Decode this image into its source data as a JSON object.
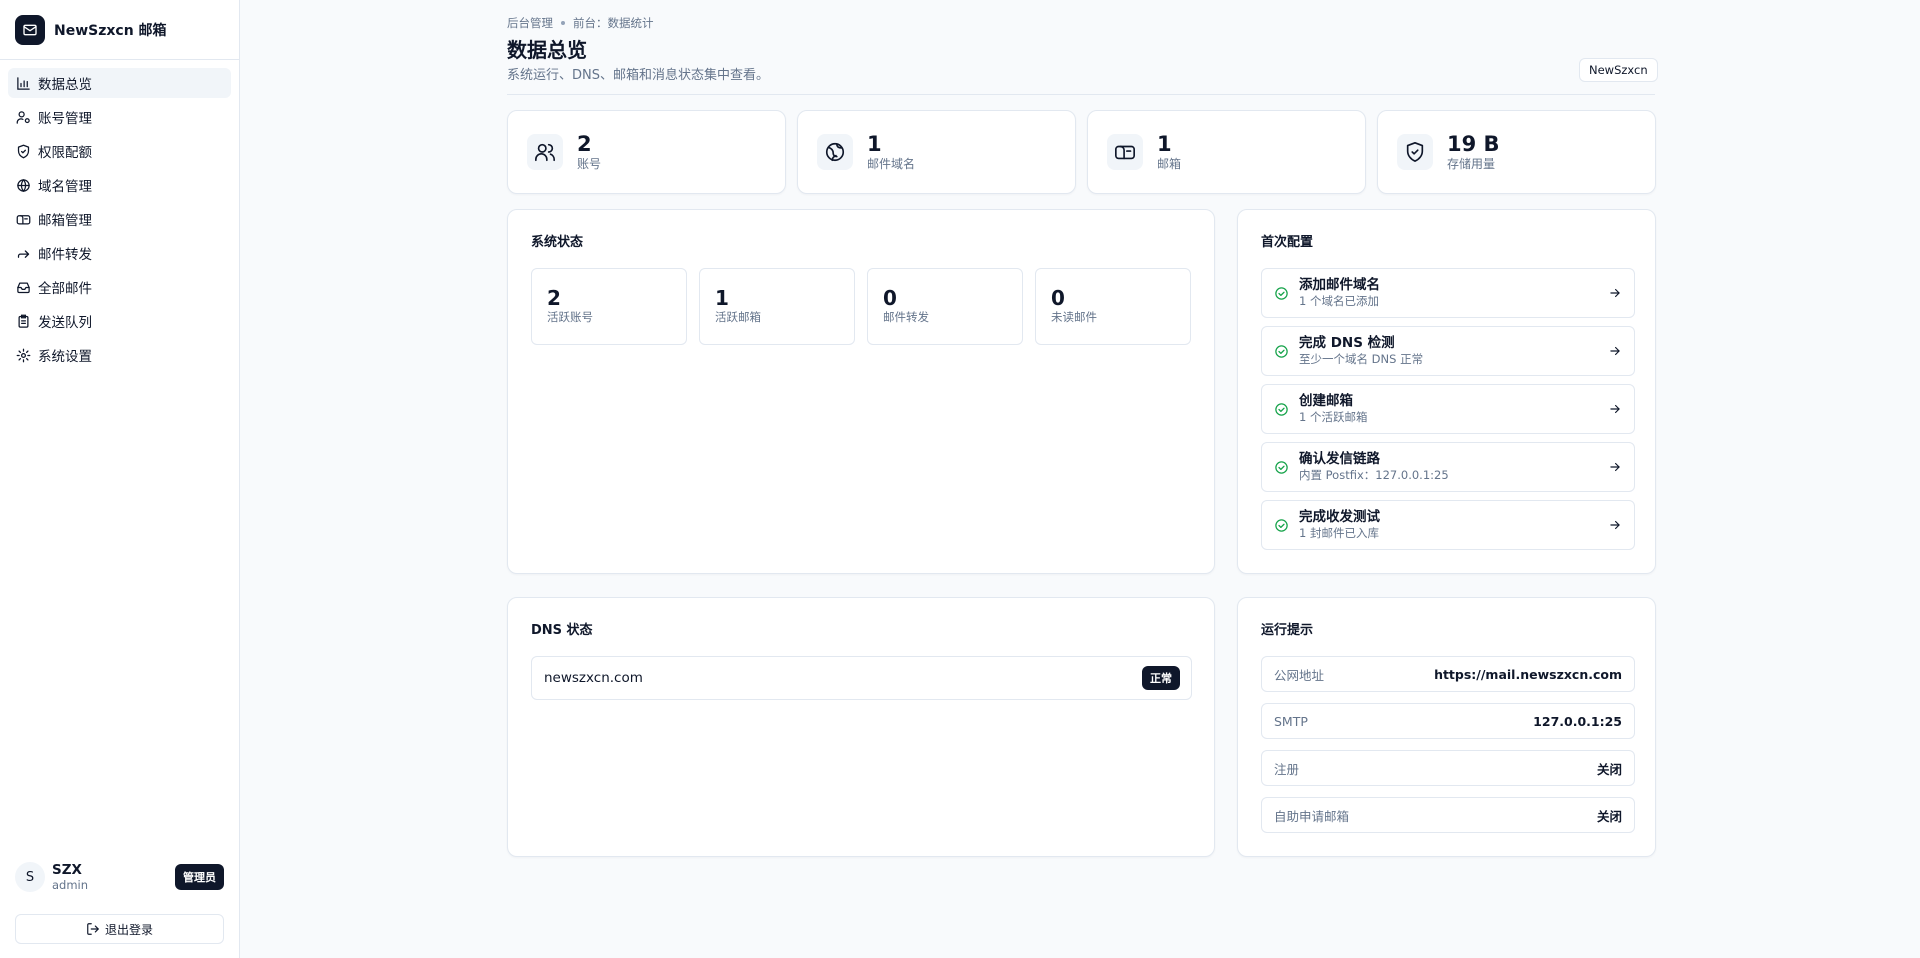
{
  "brand": {
    "name": "NewSzxcn 邮箱",
    "logo_icon": "mail-icon"
  },
  "sidebar": {
    "items": [
      {
        "label": "数据总览",
        "icon": "bar-chart-icon",
        "active": true
      },
      {
        "label": "账号管理",
        "icon": "user-settings-icon",
        "active": false
      },
      {
        "label": "权限配额",
        "icon": "shield-icon",
        "active": false
      },
      {
        "label": "域名管理",
        "icon": "globe-icon",
        "active": false
      },
      {
        "label": "邮箱管理",
        "icon": "mailbox-icon",
        "active": false
      },
      {
        "label": "邮件转发",
        "icon": "forward-icon",
        "active": false
      },
      {
        "label": "全部邮件",
        "icon": "inbox-icon",
        "active": false
      },
      {
        "label": "发送队列",
        "icon": "clipboard-icon",
        "active": false
      },
      {
        "label": "系统设置",
        "icon": "gear-icon",
        "active": false
      }
    ]
  },
  "user": {
    "initial": "S",
    "name": "SZX",
    "role": "admin",
    "badge": "管理员",
    "logout_label": "退出登录"
  },
  "header": {
    "breadcrumb": [
      "后台管理",
      "前台：数据统计"
    ],
    "title": "数据总览",
    "subtitle": "系统运行、DNS、邮箱和消息状态集中查看。",
    "tenant": "NewSzxcn"
  },
  "stats": [
    {
      "value": "2",
      "label": "账号",
      "icon": "users-icon"
    },
    {
      "value": "1",
      "label": "邮件域名",
      "icon": "globe-icon"
    },
    {
      "value": "1",
      "label": "邮箱",
      "icon": "mailbox-icon"
    },
    {
      "value": "19 B",
      "label": "存储用量",
      "icon": "shield-check-icon"
    }
  ],
  "system_status": {
    "title": "系统状态",
    "items": [
      {
        "value": "2",
        "label": "活跃账号"
      },
      {
        "value": "1",
        "label": "活跃邮箱"
      },
      {
        "value": "0",
        "label": "邮件转发"
      },
      {
        "value": "0",
        "label": "未读邮件"
      }
    ]
  },
  "setup": {
    "title": "首次配置",
    "steps": [
      {
        "title": "添加邮件域名",
        "desc": "1 个域名已添加"
      },
      {
        "title": "完成 DNS 检测",
        "desc": "至少一个域名 DNS 正常"
      },
      {
        "title": "创建邮箱",
        "desc": "1 个活跃邮箱"
      },
      {
        "title": "确认发信链路",
        "desc": "内置 Postfix：127.0.0.1:25"
      },
      {
        "title": "完成收发测试",
        "desc": "1 封邮件已入库"
      }
    ]
  },
  "dns": {
    "title": "DNS 状态",
    "rows": [
      {
        "domain": "newszxcn.com",
        "status": "正常"
      }
    ]
  },
  "runtime": {
    "title": "运行提示",
    "rows": [
      {
        "key": "公网地址",
        "value": "https://mail.newszxcn.com"
      },
      {
        "key": "SMTP",
        "value": "127.0.0.1:25"
      },
      {
        "key": "注册",
        "value": "关闭"
      },
      {
        "key": "自助申请邮箱",
        "value": "关闭"
      }
    ]
  },
  "colors": {
    "primary": "#0f172a",
    "success": "#16a34a",
    "border": "#e2e8f0",
    "muted": "#64748b"
  }
}
